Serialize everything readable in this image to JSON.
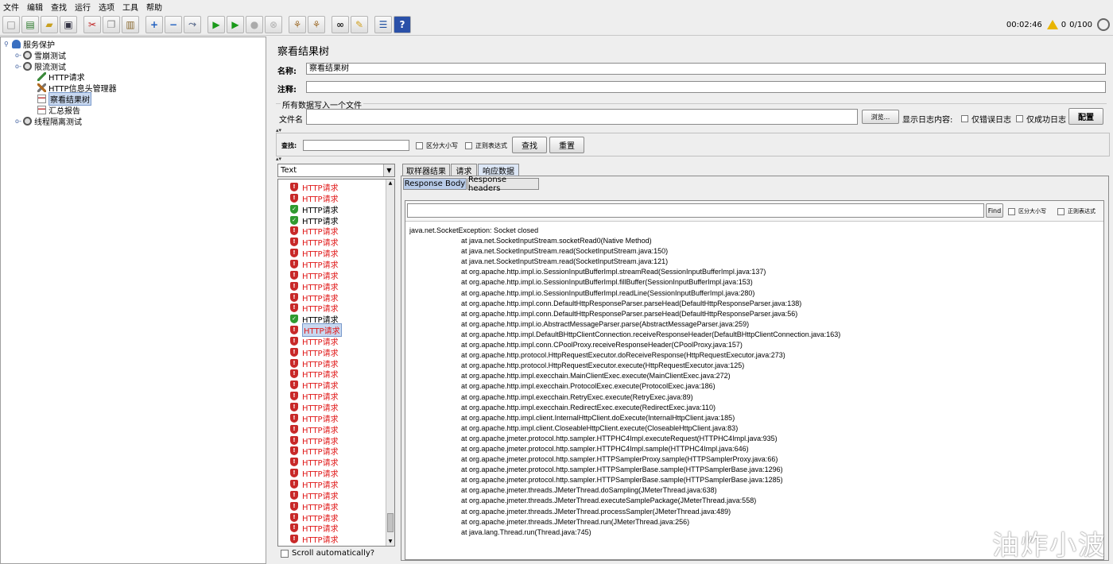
{
  "menu": [
    "文件",
    "编辑",
    "查找",
    "运行",
    "选项",
    "工具",
    "帮助"
  ],
  "toolbar": {
    "timer": "00:02:46",
    "warnings": "0",
    "threads": "0/100"
  },
  "tree": {
    "nodes": [
      {
        "label": "服务保护",
        "icon": "test-plan-icon",
        "expander": "⚲"
      },
      {
        "label": "雪崩测试",
        "icon": "thread-group-icon",
        "expander": "o-"
      },
      {
        "label": "限流测试",
        "icon": "thread-group-icon",
        "expander": "o-"
      },
      {
        "label": "HTTP请求",
        "icon": "http-sampler-icon"
      },
      {
        "label": "HTTP信息头管理器",
        "icon": "header-manager-icon"
      },
      {
        "label": "察看结果树",
        "icon": "result-tree-icon"
      },
      {
        "label": "汇总报告",
        "icon": "summary-report-icon"
      },
      {
        "label": "线程隔离测试",
        "icon": "thread-group-icon",
        "expander": "o-"
      }
    ],
    "selected_index": 5
  },
  "panel": {
    "title": "察看结果树",
    "name_label": "名称:",
    "name_value": "察看结果树",
    "comment_label": "注释:",
    "comment_value": "",
    "file_section": "所有数据写入一个文件",
    "filename_label": "文件名",
    "filename_value": "",
    "browse_button": "浏览...",
    "log_content_label": "显示日志内容:",
    "errors_only": "仅错误日志",
    "success_only": "仅成功日志",
    "configure_button": "配置"
  },
  "search": {
    "label": "查找:",
    "value": "",
    "case_sensitive": "区分大小写",
    "regex": "正则表达式",
    "find_button": "查找",
    "reset_button": "重置"
  },
  "results": {
    "renderer": "Text",
    "items": [
      {
        "label": "HTTP请求",
        "status": "fail"
      },
      {
        "label": "HTTP请求",
        "status": "fail"
      },
      {
        "label": "HTTP请求",
        "status": "ok"
      },
      {
        "label": "HTTP请求",
        "status": "ok"
      },
      {
        "label": "HTTP请求",
        "status": "fail"
      },
      {
        "label": "HTTP请求",
        "status": "fail"
      },
      {
        "label": "HTTP请求",
        "status": "fail"
      },
      {
        "label": "HTTP请求",
        "status": "fail"
      },
      {
        "label": "HTTP请求",
        "status": "fail"
      },
      {
        "label": "HTTP请求",
        "status": "fail"
      },
      {
        "label": "HTTP请求",
        "status": "fail"
      },
      {
        "label": "HTTP请求",
        "status": "fail"
      },
      {
        "label": "HTTP请求",
        "status": "ok"
      },
      {
        "label": "HTTP请求",
        "status": "fail"
      },
      {
        "label": "HTTP请求",
        "status": "fail"
      },
      {
        "label": "HTTP请求",
        "status": "fail"
      },
      {
        "label": "HTTP请求",
        "status": "fail"
      },
      {
        "label": "HTTP请求",
        "status": "fail"
      },
      {
        "label": "HTTP请求",
        "status": "fail"
      },
      {
        "label": "HTTP请求",
        "status": "fail"
      },
      {
        "label": "HTTP请求",
        "status": "fail"
      },
      {
        "label": "HTTP请求",
        "status": "fail"
      },
      {
        "label": "HTTP请求",
        "status": "fail"
      },
      {
        "label": "HTTP请求",
        "status": "fail"
      },
      {
        "label": "HTTP请求",
        "status": "fail"
      },
      {
        "label": "HTTP请求",
        "status": "fail"
      },
      {
        "label": "HTTP请求",
        "status": "fail"
      },
      {
        "label": "HTTP请求",
        "status": "fail"
      },
      {
        "label": "HTTP请求",
        "status": "fail"
      },
      {
        "label": "HTTP请求",
        "status": "fail"
      },
      {
        "label": "HTTP请求",
        "status": "fail"
      },
      {
        "label": "HTTP请求",
        "status": "fail"
      },
      {
        "label": "HTTP请求",
        "status": "fail"
      }
    ],
    "selected_index": 13,
    "scroll_auto": "Scroll automatically?"
  },
  "tabs": {
    "outer": [
      "取样器结果",
      "请求",
      "响应数据"
    ],
    "outer_active": 2,
    "inner": [
      "Response Body",
      "Response headers"
    ],
    "inner_active": 0,
    "find_button": "Find",
    "find_case": "区分大小写",
    "find_regex": "正则表达式"
  },
  "response_body": {
    "first_line": "java.net.SocketException: Socket closed",
    "stack": [
      "at java.net.SocketInputStream.socketRead0(Native Method)",
      "at java.net.SocketInputStream.read(SocketInputStream.java:150)",
      "at java.net.SocketInputStream.read(SocketInputStream.java:121)",
      "at org.apache.http.impl.io.SessionInputBufferImpl.streamRead(SessionInputBufferImpl.java:137)",
      "at org.apache.http.impl.io.SessionInputBufferImpl.fillBuffer(SessionInputBufferImpl.java:153)",
      "at org.apache.http.impl.io.SessionInputBufferImpl.readLine(SessionInputBufferImpl.java:280)",
      "at org.apache.http.impl.conn.DefaultHttpResponseParser.parseHead(DefaultHttpResponseParser.java:138)",
      "at org.apache.http.impl.conn.DefaultHttpResponseParser.parseHead(DefaultHttpResponseParser.java:56)",
      "at org.apache.http.impl.io.AbstractMessageParser.parse(AbstractMessageParser.java:259)",
      "at org.apache.http.impl.DefaultBHttpClientConnection.receiveResponseHeader(DefaultBHttpClientConnection.java:163)",
      "at org.apache.http.impl.conn.CPoolProxy.receiveResponseHeader(CPoolProxy.java:157)",
      "at org.apache.http.protocol.HttpRequestExecutor.doReceiveResponse(HttpRequestExecutor.java:273)",
      "at org.apache.http.protocol.HttpRequestExecutor.execute(HttpRequestExecutor.java:125)",
      "at org.apache.http.impl.execchain.MainClientExec.execute(MainClientExec.java:272)",
      "at org.apache.http.impl.execchain.ProtocolExec.execute(ProtocolExec.java:186)",
      "at org.apache.http.impl.execchain.RetryExec.execute(RetryExec.java:89)",
      "at org.apache.http.impl.execchain.RedirectExec.execute(RedirectExec.java:110)",
      "at org.apache.http.impl.client.InternalHttpClient.doExecute(InternalHttpClient.java:185)",
      "at org.apache.http.impl.client.CloseableHttpClient.execute(CloseableHttpClient.java:83)",
      "at org.apache.jmeter.protocol.http.sampler.HTTPHC4Impl.executeRequest(HTTPHC4Impl.java:935)",
      "at org.apache.jmeter.protocol.http.sampler.HTTPHC4Impl.sample(HTTPHC4Impl.java:646)",
      "at org.apache.jmeter.protocol.http.sampler.HTTPSamplerProxy.sample(HTTPSamplerProxy.java:66)",
      "at org.apache.jmeter.protocol.http.sampler.HTTPSamplerBase.sample(HTTPSamplerBase.java:1296)",
      "at org.apache.jmeter.protocol.http.sampler.HTTPSamplerBase.sample(HTTPSamplerBase.java:1285)",
      "at org.apache.jmeter.threads.JMeterThread.doSampling(JMeterThread.java:638)",
      "at org.apache.jmeter.threads.JMeterThread.executeSamplePackage(JMeterThread.java:558)",
      "at org.apache.jmeter.threads.JMeterThread.processSampler(JMeterThread.java:489)",
      "at org.apache.jmeter.threads.JMeterThread.run(JMeterThread.java:256)",
      "at java.lang.Thread.run(Thread.java:745)"
    ]
  },
  "watermark": "油炸小波"
}
